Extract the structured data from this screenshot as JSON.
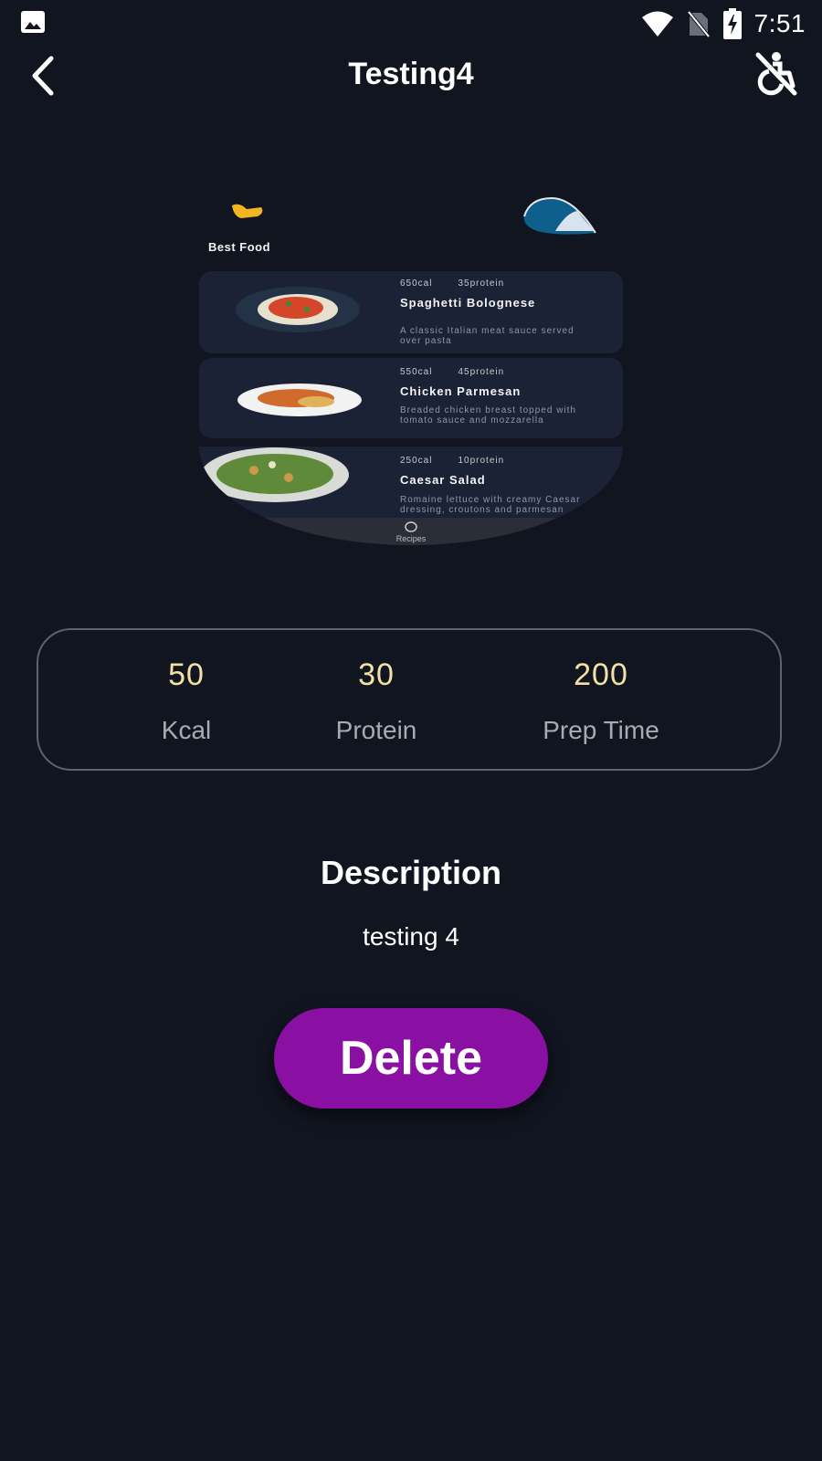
{
  "status_bar": {
    "time": "7:51",
    "icons": [
      "image-icon",
      "wifi-icon",
      "no-sim-icon",
      "battery-charging-icon"
    ]
  },
  "app_bar": {
    "title": "Testing4",
    "back_icon": "chevron-left-icon",
    "action_icon": "accessibility-off-icon"
  },
  "preview": {
    "brand": "Best Food",
    "items": [
      {
        "cal": "650cal",
        "protein": "35protein",
        "name": "Spaghetti Bolognese",
        "desc": "A classic Italian meat sauce served over pasta"
      },
      {
        "cal": "550cal",
        "protein": "45protein",
        "name": "Chicken Parmesan",
        "desc": "Breaded chicken breast topped with tomato sauce and mozzarella"
      },
      {
        "cal": "250cal",
        "protein": "10protein",
        "name": "Caesar Salad",
        "desc": "Romaine lettuce with creamy Caesar dressing, croutons and parmesan"
      }
    ],
    "nav_label": "Recipes"
  },
  "stats": [
    {
      "value": "50",
      "label": "Kcal"
    },
    {
      "value": "30",
      "label": "Protein"
    },
    {
      "value": "200",
      "label": "Prep Time"
    }
  ],
  "description": {
    "title": "Description",
    "text": "testing 4"
  },
  "delete_label": "Delete",
  "colors": {
    "background": "#111520",
    "accent": "#8a0fa3",
    "stat_value": "#f3e1a6",
    "stat_label": "#a9abb2"
  }
}
